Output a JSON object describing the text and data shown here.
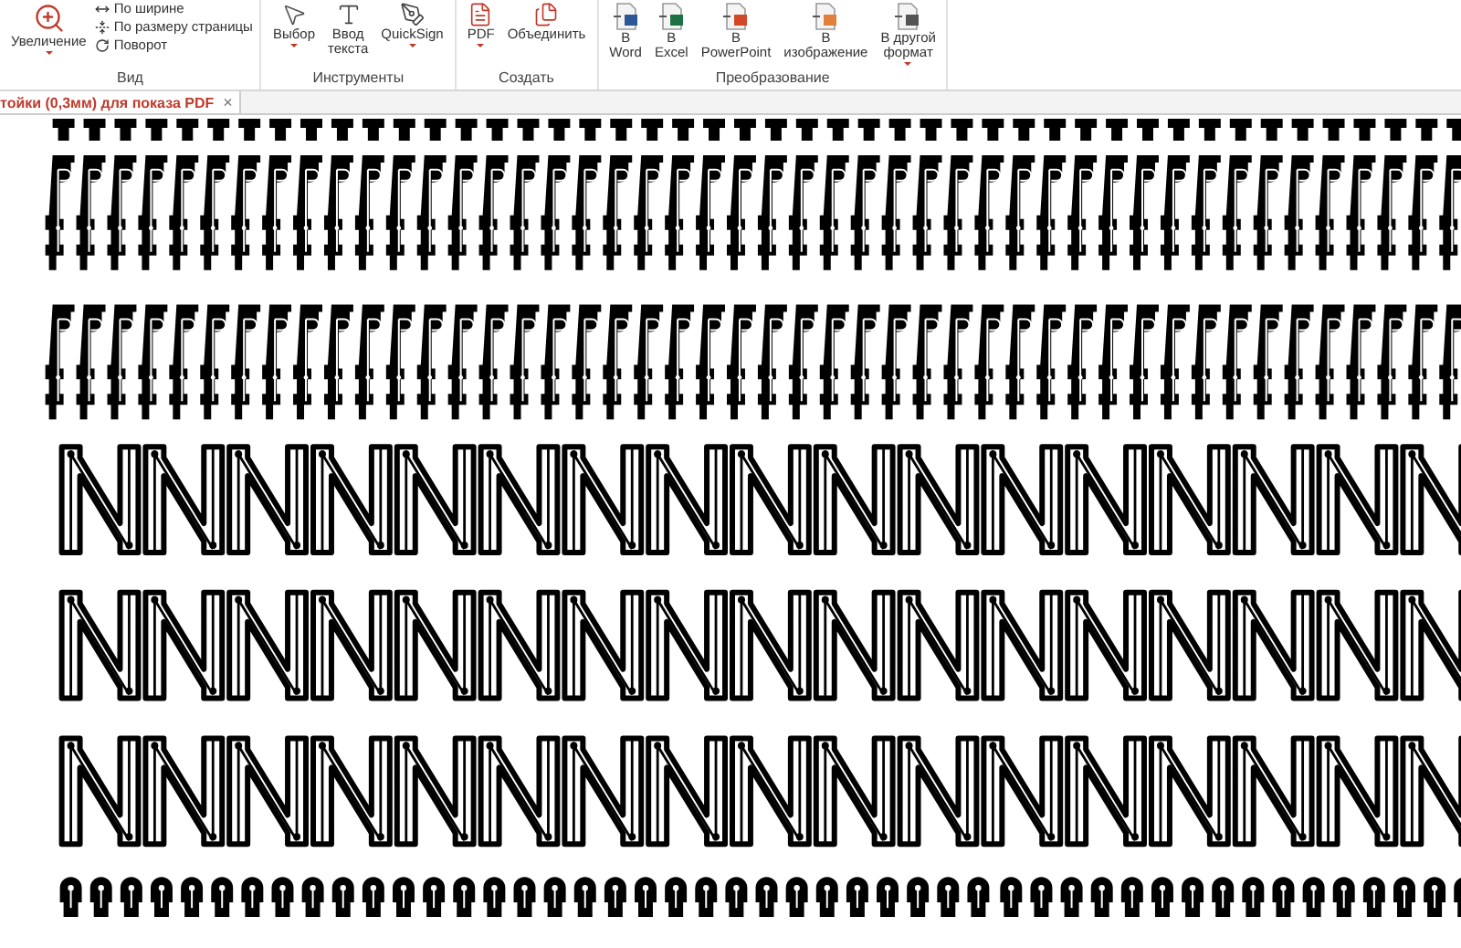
{
  "ribbon": {
    "groups": [
      {
        "label": "Вид",
        "large": [
          {
            "label": "Увеличение",
            "dropdown": true
          }
        ],
        "small": [
          {
            "label": "По ширине"
          },
          {
            "label": "По размеру страницы"
          },
          {
            "label": "Поворот"
          }
        ]
      },
      {
        "label": "Инструменты",
        "large": [
          {
            "label": "Выбор",
            "dropdown": true
          },
          {
            "label": "Ввод\nтекста",
            "dropdown": false
          },
          {
            "label": "QuickSign",
            "dropdown": true
          }
        ]
      },
      {
        "label": "Создать",
        "large": [
          {
            "label": "PDF",
            "dropdown": true
          },
          {
            "label": "Объединить",
            "dropdown": false
          }
        ]
      },
      {
        "label": "Преобразование",
        "large": [
          {
            "label": "В\nWord",
            "dropdown": false,
            "color": "#2b5797"
          },
          {
            "label": "В\nExcel",
            "dropdown": false,
            "color": "#1e7145"
          },
          {
            "label": "В\nPowerPoint",
            "dropdown": false,
            "color": "#d24726"
          },
          {
            "label": "В\nизображение",
            "dropdown": false,
            "color": "#e0803a"
          },
          {
            "label": "В другой\nформат",
            "dropdown": true,
            "color": "#555555"
          }
        ]
      }
    ]
  },
  "tabs": [
    {
      "label": "тойки (0,3мм) для показа PDF",
      "selected": true,
      "close": "×"
    }
  ]
}
